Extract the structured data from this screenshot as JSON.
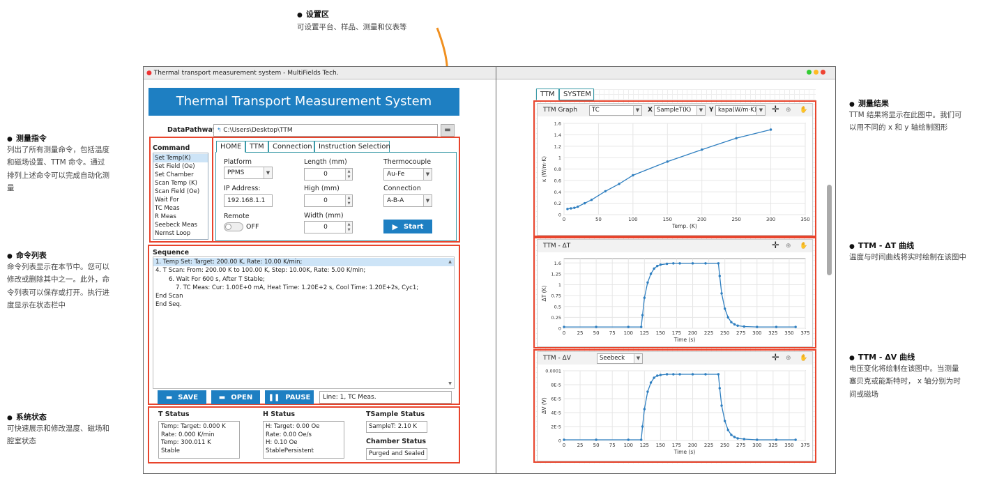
{
  "annotations": {
    "settings": {
      "title": "设置区",
      "desc": "可设置平台、样品、测量和仪表等"
    },
    "commands": {
      "title": "测量指令",
      "desc": [
        "列出了所有测量命令，包括温度",
        "和磁场设置、TTM  命令。通过",
        "排列上述命令可以完成自动化测",
        "量"
      ]
    },
    "sequence": {
      "title": "命令列表",
      "desc": [
        "命令列表显示在本节中。您可以",
        "修改或删除其中之一。此外，命",
        "令列表可以保存或打开。执行进",
        "度显示在状态栏中"
      ]
    },
    "status": {
      "title": "系统状态",
      "desc": [
        "可快速展示和修改温度、磁场和",
        "腔室状态"
      ]
    },
    "results": {
      "title": "测量结果",
      "desc": [
        "TTM 结果将显示在此图中。我们可",
        "以用不同的 x 和 y 轴绘制图形"
      ]
    },
    "dt_curve": {
      "title": "TTM - ΔT 曲线",
      "desc": [
        "温度与时间曲线将实时绘制在该图中"
      ]
    },
    "dv_curve": {
      "title": "TTM - ΔV 曲线",
      "desc": [
        "电压变化将绘制在该图中。当测量",
        "塞贝克或能斯特时， x  轴分别为时",
        "间或磁场"
      ]
    }
  },
  "window": {
    "title": "Thermal transport measurement system - MultiFields Tech."
  },
  "app": {
    "header": "Thermal Transport Measurement System",
    "datapath_label": "DataPathway",
    "datapath_value": "C:\\Users\\Desktop\\TTM",
    "command_title": "Command",
    "commands": [
      "Set Temp(K)",
      "Set Field (Oe)",
      "Set Chamber",
      "Scan Temp (K)",
      "Scan Field (Oe)",
      "Wait For",
      "TC Meas",
      "R Meas",
      "Seebeck Meas",
      "Nernst Loop"
    ],
    "tabs": [
      "HOME",
      "TTM",
      "Connection",
      "Instruction Selection"
    ],
    "home": {
      "platform_label": "Platform",
      "platform_value": "PPMS",
      "ip_label": "IP Address:",
      "ip_value": "192.168.1.1",
      "remote_label": "Remote",
      "remote_state": "OFF",
      "length_label": "Length (mm)",
      "length_value": "0",
      "high_label": "High (mm)",
      "high_value": "0",
      "width_label": "Width (mm)",
      "width_value": "0",
      "thermo_label": "Thermocouple",
      "thermo_value": "Au-Fe",
      "conn_label": "Connection",
      "conn_value": "A-B-A",
      "start_label": "Start"
    },
    "sequence_title": "Sequence",
    "sequence_lines": [
      "1. Temp Set: Target: 200.00 K, Rate: 10.00 K/min;",
      "4. T Scan: From: 200.00 K to 100.00 K, Step: 10.00K, Rate: 5.00 K/min;",
      "6. Wait For 600 s, After T Stable;",
      "7. TC Meas: Cur: 1.00E+0 mA, Heat Time: 1.20E+2 s, Cool Time: 1.20E+2s, Cyc1;",
      "End Scan",
      "End Seq."
    ],
    "buttons": {
      "save": "SAVE",
      "open": "OPEN",
      "pause": "PAUSE"
    },
    "line_status": "Line: 1, TC Meas.",
    "t_status": {
      "title": "T Status",
      "lines": [
        "Temp: Target: 0.000 K",
        "Rate: 0.000 K/min",
        "Temp: 300.011 K",
        "Stable"
      ]
    },
    "h_status": {
      "title": "H Status",
      "lines": [
        "H: Target: 0.00 Oe",
        "Rate: 0.00 Oe/s",
        "H: 0.10 Oe",
        "StablePersistent"
      ]
    },
    "tsample_status": {
      "title": "TSample Status",
      "value": "SampleT: 2.10 K"
    },
    "chamber_status": {
      "title": "Chamber Status",
      "value": "Purged and Sealed"
    }
  },
  "right": {
    "tabs": [
      "TTM",
      "SYSTEM"
    ],
    "graph1": {
      "title": "TTM Graph",
      "combo1": "TC",
      "x_label": "X",
      "x_combo": "SampleT(K)",
      "y_label": "Y",
      "y_combo": "kapa(W/m·K)"
    },
    "graph2": {
      "title": "TTM - ΔT"
    },
    "graph3": {
      "title": "TTM - ΔV",
      "combo": "Seebeck"
    }
  },
  "chart_data": [
    {
      "type": "line",
      "xlabel": "Temp. (K)",
      "ylabel": "κ (W/m·K)",
      "xlim": [
        0,
        350
      ],
      "ylim": [
        0,
        1.6
      ],
      "xticks": [
        0,
        50,
        100,
        150,
        200,
        250,
        300,
        350
      ],
      "yticks": [
        0,
        0.2,
        0.4,
        0.6,
        0.8,
        1,
        1.2,
        1.4,
        1.6
      ],
      "ytick_labels": [
        "0",
        "0.2",
        "0.4",
        "0.6",
        "0.8",
        "1",
        "1.2",
        "1.4",
        "1.6"
      ],
      "x": [
        5,
        10,
        15,
        20,
        30,
        40,
        60,
        80,
        100,
        150,
        200,
        250,
        300
      ],
      "y": [
        0.1,
        0.11,
        0.12,
        0.14,
        0.2,
        0.26,
        0.41,
        0.54,
        0.69,
        0.93,
        1.14,
        1.34,
        1.49
      ]
    },
    {
      "type": "line",
      "xlabel": "Time (s)",
      "ylabel": "ΔT (K)",
      "xlim": [
        0,
        375
      ],
      "ylim": [
        0,
        1.6
      ],
      "xticks": [
        0,
        25,
        50,
        75,
        100,
        125,
        150,
        175,
        200,
        225,
        250,
        275,
        300,
        325,
        350,
        375
      ],
      "yticks": [
        0,
        0.25,
        0.5,
        0.75,
        1,
        1.25,
        1.5
      ],
      "ytick_labels": [
        "0",
        "0.25",
        "0.5",
        "0.75",
        "1",
        "1.25",
        "1.6"
      ],
      "x": [
        0,
        50,
        100,
        120,
        122,
        125,
        130,
        135,
        140,
        145,
        150,
        160,
        170,
        180,
        200,
        220,
        240,
        242,
        245,
        250,
        255,
        260,
        265,
        270,
        280,
        300,
        330,
        360
      ],
      "y": [
        0.03,
        0.03,
        0.03,
        0.03,
        0.3,
        0.7,
        1.05,
        1.25,
        1.37,
        1.43,
        1.46,
        1.48,
        1.49,
        1.49,
        1.49,
        1.49,
        1.49,
        1.2,
        0.8,
        0.45,
        0.25,
        0.14,
        0.09,
        0.06,
        0.04,
        0.03,
        0.03,
        0.03
      ]
    },
    {
      "type": "line",
      "xlabel": "Time (s)",
      "ylabel": "ΔV (V)",
      "xlim": [
        0,
        375
      ],
      "ylim": [
        0,
        0.0001
      ],
      "xticks": [
        0,
        25,
        50,
        75,
        100,
        125,
        150,
        175,
        200,
        225,
        250,
        275,
        300,
        325,
        350,
        375
      ],
      "yticks": [
        0,
        2e-05,
        4e-05,
        6e-05,
        8e-05,
        0.0001
      ],
      "ytick_labels": [
        "0",
        "2E-5",
        "4E-5",
        "6E-5",
        "8E-5",
        "0.0001"
      ],
      "x": [
        0,
        50,
        100,
        120,
        122,
        125,
        130,
        135,
        140,
        145,
        150,
        160,
        170,
        180,
        200,
        220,
        240,
        242,
        245,
        250,
        255,
        260,
        265,
        270,
        280,
        300,
        330,
        360
      ],
      "y": [
        1e-06,
        1e-06,
        1e-06,
        1e-06,
        2e-05,
        4.5e-05,
        7e-05,
        8.3e-05,
        9e-05,
        9.3e-05,
        9.4e-05,
        9.5e-05,
        9.5e-05,
        9.5e-05,
        9.5e-05,
        9.5e-05,
        9.5e-05,
        7.5e-05,
        5e-05,
        2.8e-05,
        1.5e-05,
        8e-06,
        5e-06,
        3e-06,
        2e-06,
        1e-06,
        1e-06,
        1e-06
      ]
    }
  ]
}
